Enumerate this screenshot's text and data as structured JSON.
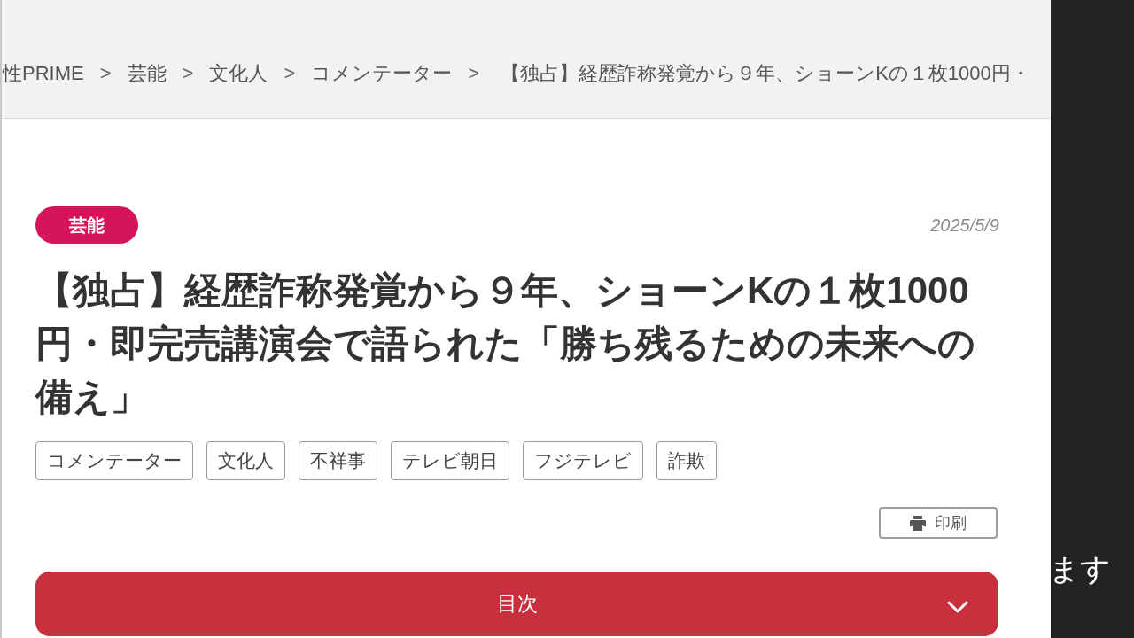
{
  "breadcrumb": [
    {
      "kind": "link",
      "label": "性PRIME"
    },
    {
      "kind": "separator",
      "label": ">"
    },
    {
      "kind": "link",
      "label": "芸能"
    },
    {
      "kind": "separator",
      "label": ">"
    },
    {
      "kind": "link",
      "label": "文化人"
    },
    {
      "kind": "separator",
      "label": ">"
    },
    {
      "kind": "link",
      "label": "コメンテーター"
    },
    {
      "kind": "separator",
      "label": ">"
    },
    {
      "kind": "current",
      "label": "【独占】経歴詐称発覚から９年、ショーンKの１枚1000円・"
    }
  ],
  "article": {
    "category": "芸能",
    "date": "2025/5/9",
    "title": "【独占】経歴詐称発覚から９年、ショーンKの１枚1000円・即完売講演会で語られた「勝ち残るための未来への備え」",
    "tags": [
      "コメンテーター",
      "文化人",
      "不祥事",
      "テレビ朝日",
      "フジテレビ",
      "詐欺"
    ],
    "print_button": "印刷",
    "toc": {
      "label": "目次",
      "expanded": false
    }
  },
  "side_panel": {
    "caption": "ます"
  }
}
